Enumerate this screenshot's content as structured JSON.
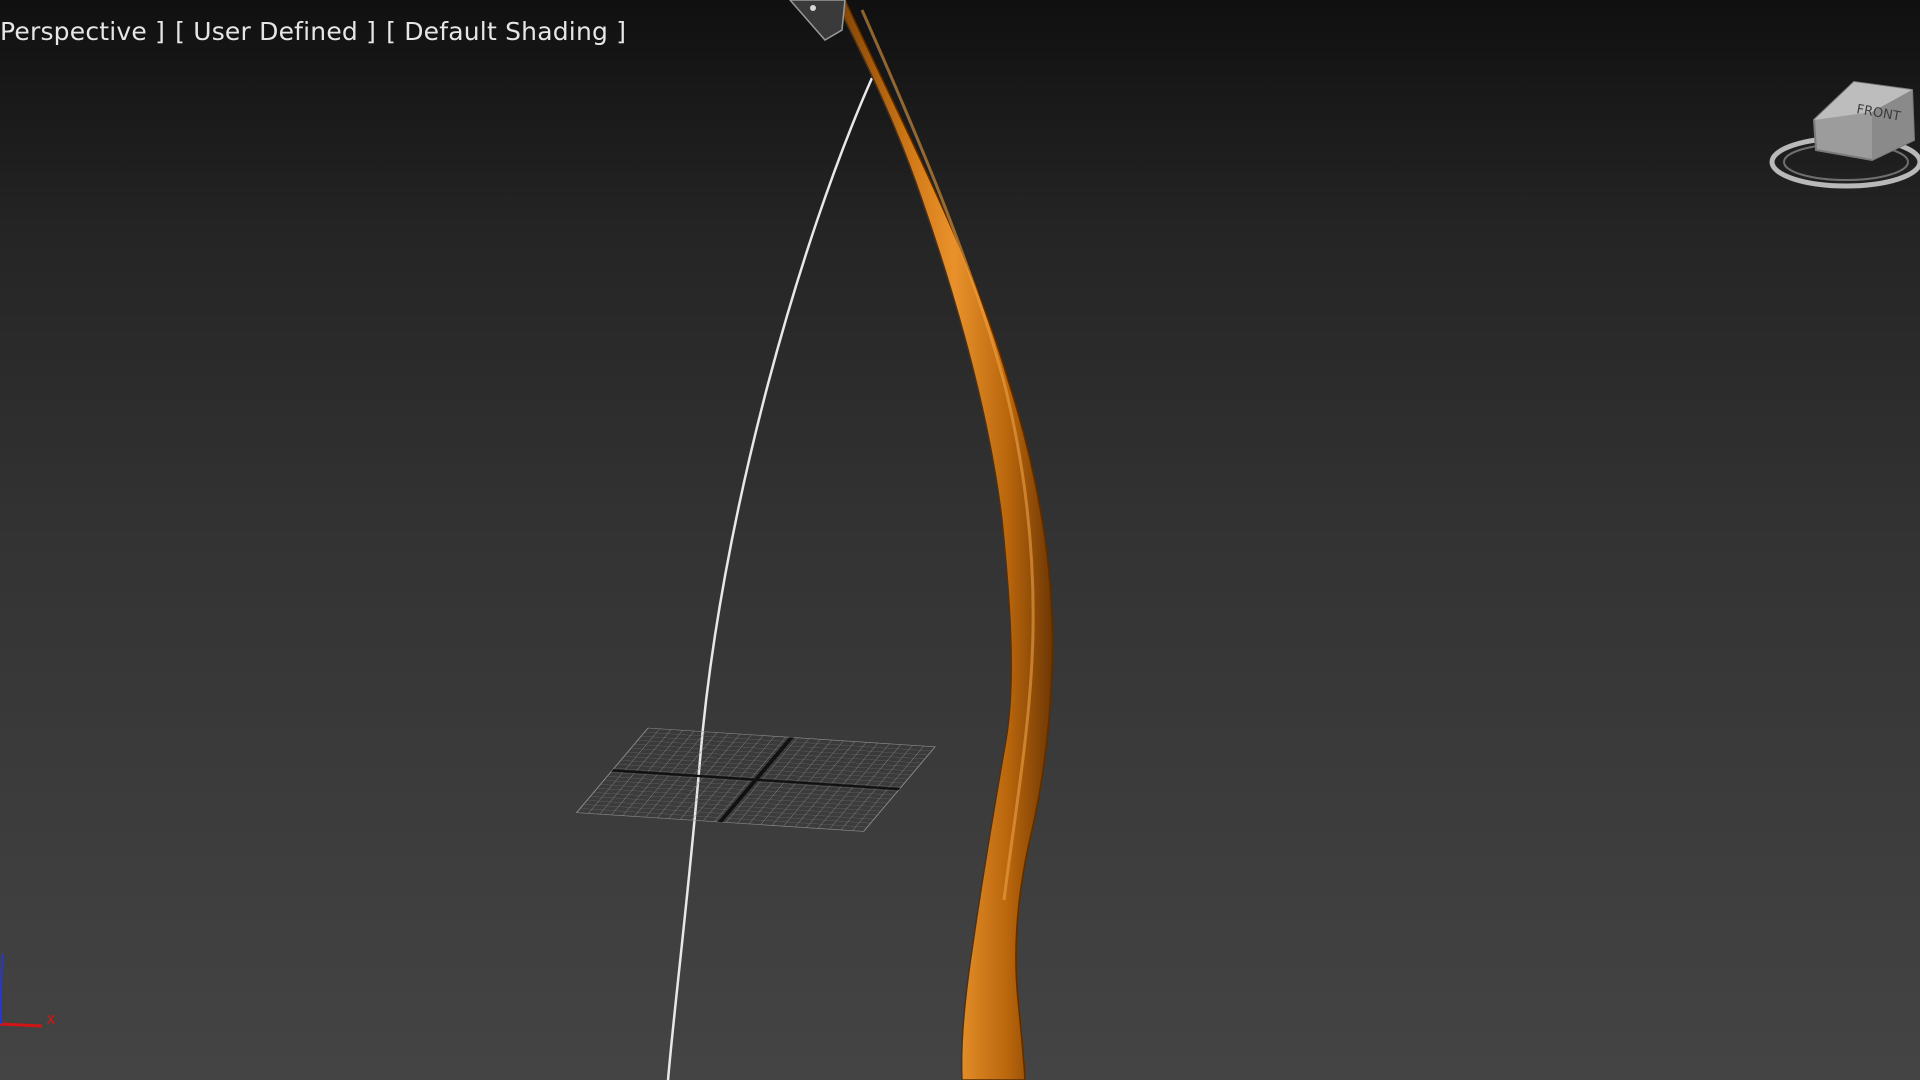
{
  "viewport": {
    "label_view": "Perspective ]",
    "label_preset": "[ User Defined ]",
    "label_shading": "[ Default Shading ]"
  },
  "viewcube": {
    "face_label": "FRONT",
    "icon": "viewcube-icon"
  },
  "axis_gizmo": {
    "x_label": "x",
    "icon": "axis-tripod-icon"
  },
  "scene_objects": {
    "bow_limb": "bow-limb",
    "bow_string": "bow-string",
    "grid": "home-grid",
    "arrow_tip": "arrow-tip"
  },
  "colors": {
    "bow_wood": "#b8650c",
    "bow_highlight": "#e9922c",
    "bow_shadow": "#7a3f04",
    "string": "#e8e8e8",
    "grid": "#8a8a8a",
    "axis_x": "#d21414",
    "axis_z": "#2a38c8"
  }
}
